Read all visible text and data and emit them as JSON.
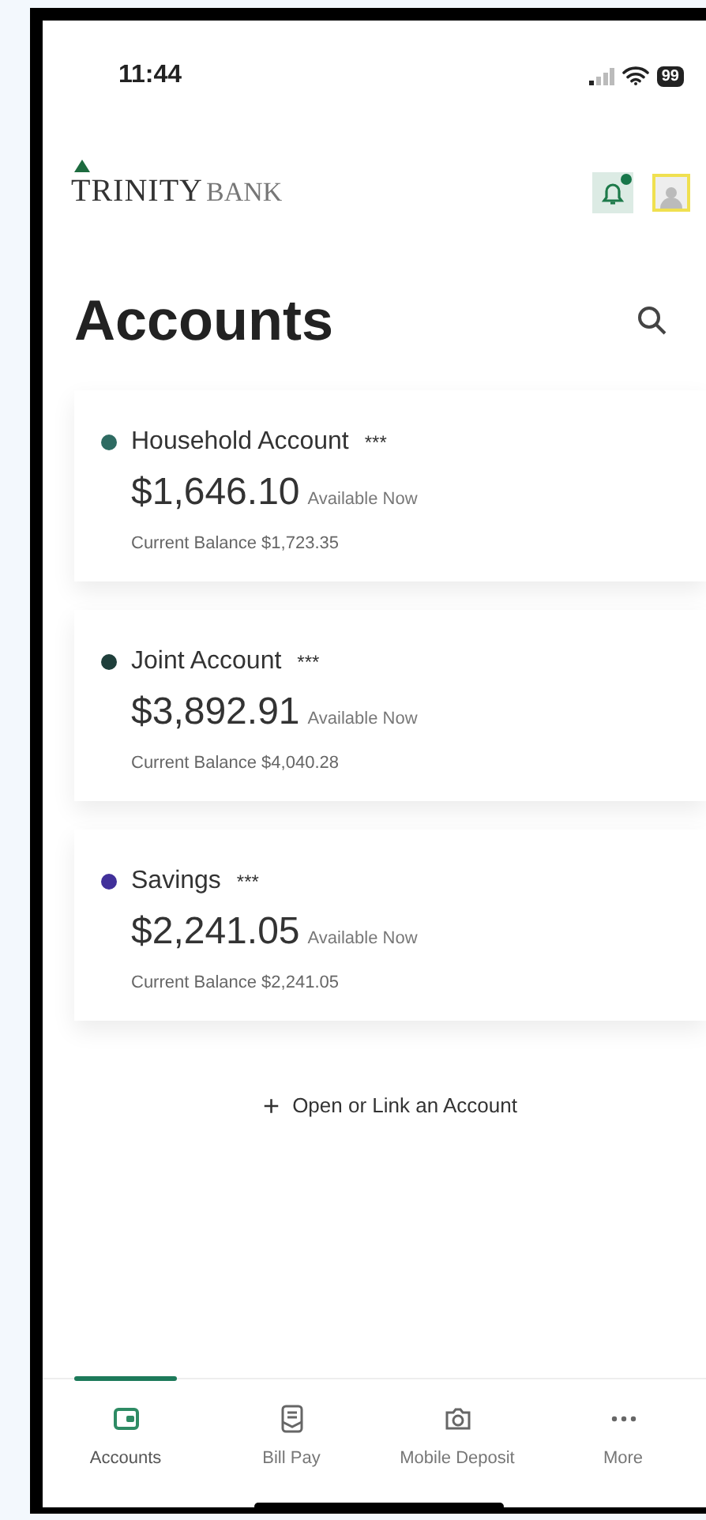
{
  "status_bar": {
    "time": "11:44",
    "battery": "99"
  },
  "header": {
    "logo": {
      "word_1": "TRINITY",
      "word_2": "BANK"
    },
    "notifications": {
      "unread": true
    }
  },
  "title": "Accounts",
  "accounts": [
    {
      "name": "Household Account",
      "mask": "***",
      "available": "$1,646.10",
      "available_label": "Available Now",
      "current": "Current Balance $1,723.35",
      "color": "#2e6b62"
    },
    {
      "name": "Joint Account",
      "mask": "***",
      "available": "$3,892.91",
      "available_label": "Available Now",
      "current": "Current Balance $4,040.28",
      "color": "#1f3f3b"
    },
    {
      "name": "Savings",
      "mask": "***",
      "available": "$2,241.05",
      "available_label": "Available Now",
      "current": "Current Balance $2,241.05",
      "color": "#41309a"
    }
  ],
  "add_link": {
    "icon": "+",
    "label": "Open or Link an Account"
  },
  "tabs": [
    {
      "kind": "wallet",
      "label": "Accounts",
      "selected": true
    },
    {
      "kind": "bill",
      "label": "Bill Pay",
      "selected": false
    },
    {
      "kind": "camera",
      "label": "Mobile Deposit",
      "selected": false
    },
    {
      "kind": "more",
      "label": "More",
      "selected": false
    }
  ]
}
